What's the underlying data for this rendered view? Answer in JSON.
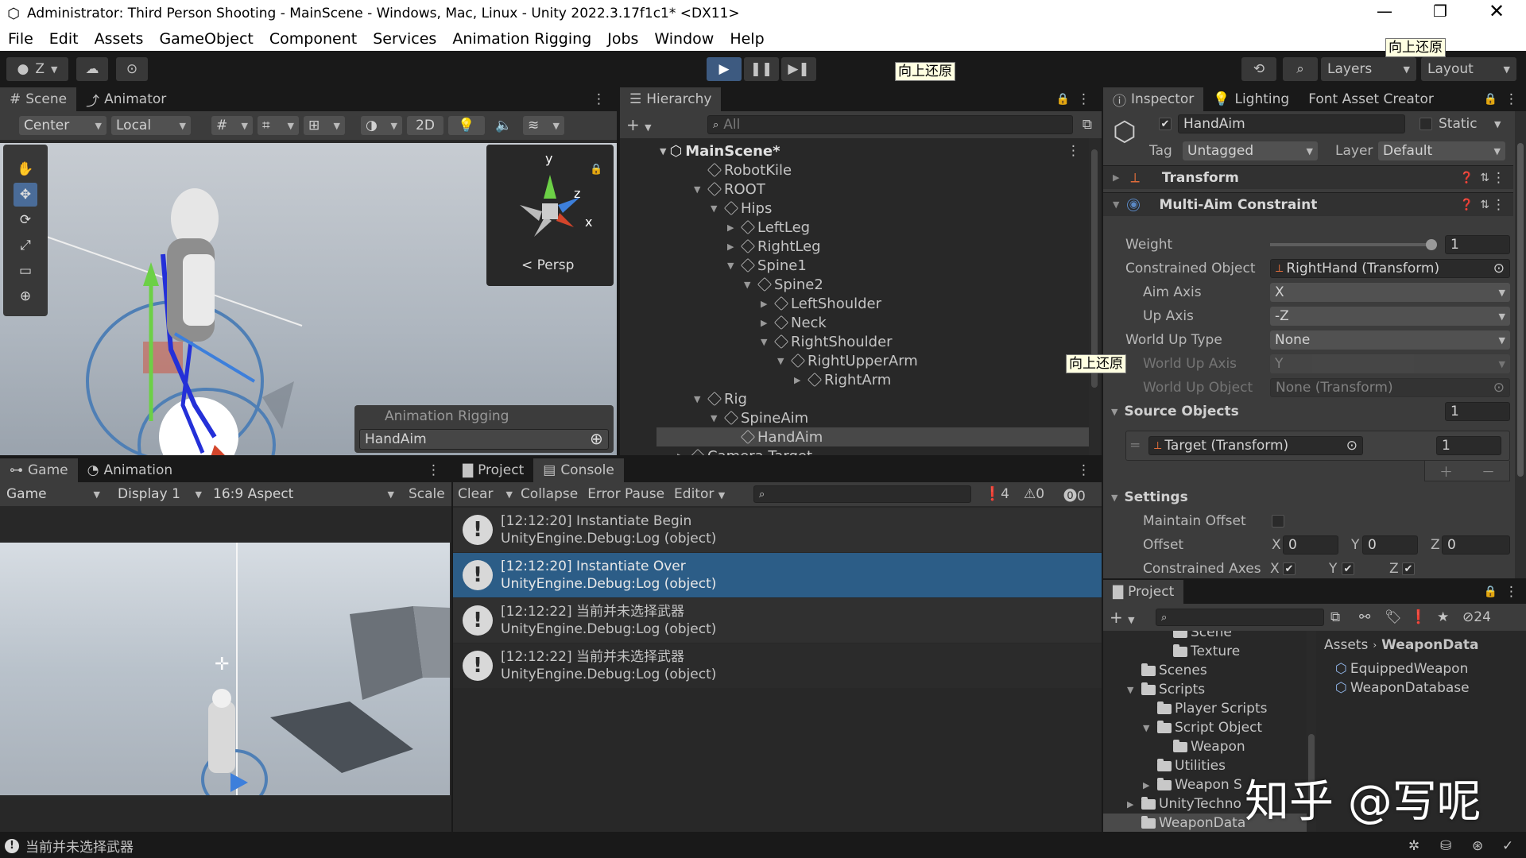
{
  "window": {
    "title": "Administrator: Third Person Shooting - MainScene - Windows, Mac, Linux - Unity 2022.3.17f1c1* <DX11>"
  },
  "menu": [
    "File",
    "Edit",
    "Assets",
    "GameObject",
    "Component",
    "Services",
    "Animation Rigging",
    "Jobs",
    "Window",
    "Help"
  ],
  "toolbar": {
    "account": "Z",
    "layers": "Layers",
    "layout": "Layout"
  },
  "tooltips": {
    "text": "向上还原"
  },
  "scene": {
    "tabs": [
      "Scene",
      "Animator"
    ],
    "pivot": "Center",
    "space": "Local",
    "mode2d": "2D",
    "persp": "Persp",
    "overlay_title": "Animation Rigging",
    "overlay_item": "HandAim",
    "gizmo_y": "y",
    "gizmo_z": "z",
    "gizmo_x": "x"
  },
  "hierarchy": {
    "tab": "Hierarchy",
    "search": "All",
    "scene": "MainScene*",
    "items": [
      {
        "label": "RobotKile",
        "depth": 1,
        "arrow": ""
      },
      {
        "label": "ROOT",
        "depth": 1,
        "arrow": "▼"
      },
      {
        "label": "Hips",
        "depth": 2,
        "arrow": "▼"
      },
      {
        "label": "LeftLeg",
        "depth": 3,
        "arrow": "▶"
      },
      {
        "label": "RightLeg",
        "depth": 3,
        "arrow": "▶"
      },
      {
        "label": "Spine1",
        "depth": 3,
        "arrow": "▼"
      },
      {
        "label": "Spine2",
        "depth": 4,
        "arrow": "▼"
      },
      {
        "label": "LeftShoulder",
        "depth": 5,
        "arrow": "▶"
      },
      {
        "label": "Neck",
        "depth": 5,
        "arrow": "▶"
      },
      {
        "label": "RightShoulder",
        "depth": 5,
        "arrow": "▼"
      },
      {
        "label": "RightUpperArm",
        "depth": 6,
        "arrow": "▼"
      },
      {
        "label": "RightArm",
        "depth": 7,
        "arrow": "▶"
      },
      {
        "label": "Rig",
        "depth": 1,
        "arrow": "▼"
      },
      {
        "label": "SpineAim",
        "depth": 2,
        "arrow": "▼"
      },
      {
        "label": "HandAim",
        "depth": 3,
        "arrow": ""
      },
      {
        "label": "Camera Target",
        "depth": 0,
        "arrow": "▶"
      }
    ]
  },
  "inspector": {
    "tabs": [
      "Inspector",
      "Lighting",
      "Font Asset Creator"
    ],
    "object_name": "HandAim",
    "static_label": "Static",
    "tag_label": "Tag",
    "tag_value": "Untagged",
    "layer_label": "Layer",
    "layer_value": "Default",
    "transform_label": "Transform",
    "constraint_label": "Multi-Aim Constraint",
    "weight_label": "Weight",
    "weight_value": "1",
    "constrained_label": "Constrained Object",
    "constrained_value": "RightHand (Transform)",
    "aim_axis_label": "Aim Axis",
    "aim_axis_value": "X",
    "up_axis_label": "Up Axis",
    "up_axis_value": "-Z",
    "world_up_type_label": "World Up Type",
    "world_up_type_value": "None",
    "world_up_axis_label": "World Up Axis",
    "world_up_axis_value": "Y",
    "world_up_object_label": "World Up Object",
    "world_up_object_value": "None (Transform)",
    "source_label": "Source Objects",
    "source_count": "1",
    "source_target": "Target (Transform)",
    "source_weight": "1",
    "settings_label": "Settings",
    "maintain_offset_label": "Maintain Offset",
    "offset_label": "Offset",
    "offset_x": "0",
    "offset_y": "0",
    "offset_z": "0",
    "axes_label": "Constrained Axes",
    "x": "X",
    "y": "Y",
    "z": "Z"
  },
  "game": {
    "tabs": [
      "Game",
      "Animation"
    ],
    "mode": "Game",
    "display": "Display 1",
    "aspect": "16:9 Aspect",
    "scale": "Scale"
  },
  "console": {
    "tabs": [
      "Project",
      "Console"
    ],
    "clear": "Clear",
    "collapse": "Collapse",
    "error_pause": "Error Pause",
    "editor": "Editor",
    "count_log": "4",
    "count_warn": "0",
    "count_err": "0",
    "logs": [
      {
        "line1": "[12:12:20] Instantiate Begin",
        "line2": "UnityEngine.Debug:Log (object)",
        "selected": false
      },
      {
        "line1": "[12:12:20] Instantiate Over",
        "line2": "UnityEngine.Debug:Log (object)",
        "selected": true
      },
      {
        "line1": "[12:12:22] 当前并未选择武器",
        "line2": "UnityEngine.Debug:Log (object)",
        "selected": false
      },
      {
        "line1": "[12:12:22] 当前并未选择武器",
        "line2": "UnityEngine.Debug:Log (object)",
        "selected": false
      }
    ]
  },
  "project": {
    "tab": "Project",
    "hidden_count": "24",
    "breadcrumb_root": "Assets",
    "breadcrumb_leaf": "WeaponData",
    "tree": [
      {
        "label": "Scene",
        "depth": 3,
        "arrow": ""
      },
      {
        "label": "Texture",
        "depth": 3,
        "arrow": ""
      },
      {
        "label": "Scenes",
        "depth": 1,
        "arrow": ""
      },
      {
        "label": "Scripts",
        "depth": 1,
        "arrow": "▼"
      },
      {
        "label": "Player Scripts",
        "depth": 2,
        "arrow": ""
      },
      {
        "label": "Script Object",
        "depth": 2,
        "arrow": "▼"
      },
      {
        "label": "Weapon",
        "depth": 3,
        "arrow": ""
      },
      {
        "label": "Utilities",
        "depth": 2,
        "arrow": ""
      },
      {
        "label": "Weapon S",
        "depth": 2,
        "arrow": "▶"
      },
      {
        "label": "UnityTechno",
        "depth": 1,
        "arrow": "▶"
      },
      {
        "label": "WeaponData",
        "depth": 1,
        "arrow": ""
      }
    ],
    "assets": [
      "EquippedWeapon",
      "WeaponDatabase"
    ]
  },
  "status": {
    "message": "当前并未选择武器"
  },
  "watermark": "知乎 @写呢"
}
